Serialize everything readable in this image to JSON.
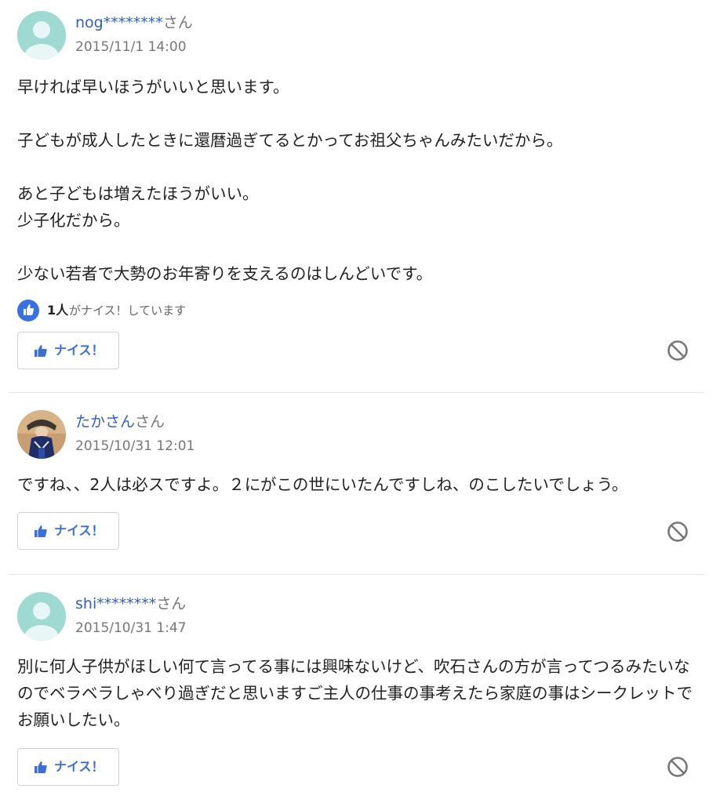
{
  "answers": [
    {
      "user": "nog********",
      "honorific": "さん",
      "date": "2015/11/1 14:00",
      "body": "早ければ早いほうがいいと思います。\n\n子どもが成人したときに還暦過ぎてるとかってお祖父ちゃんみたいだから。\n\nあと子どもは増えたほうがいい。\n少子化だから。\n\n少ない若者で大勢のお年寄りを支えるのはしんどいです。",
      "likes_count": "1人",
      "likes_text": "がナイス！しています",
      "nice_label": "ナイス！",
      "avatar": "default-avatar-icon"
    },
    {
      "user": "たかさん",
      "honorific": "さん",
      "date": "2015/10/31 12:01",
      "body": "ですね、、2人は必スですよ。２にがこの世にいたんですしね、のこしたいでしょう。",
      "nice_label": "ナイス！",
      "avatar": "user-photo-avatar"
    },
    {
      "user": "shi********",
      "honorific": "さん",
      "date": "2015/10/31 1:47",
      "body": "別に何人子供がほしい何て言ってる事には興味ないけど、吹石さんの方が言ってつるみたいなのでベラベラしゃべり過ぎだと思いますご主人の仕事の事考えたら家庭の事はシークレットでお願いしたい。",
      "nice_label": "ナイス！",
      "avatar": "default-avatar-icon"
    }
  ],
  "colors": {
    "link": "#2f5fc4",
    "accent": "#3a6fd8",
    "avatar_bg": "#9ed9d2"
  }
}
